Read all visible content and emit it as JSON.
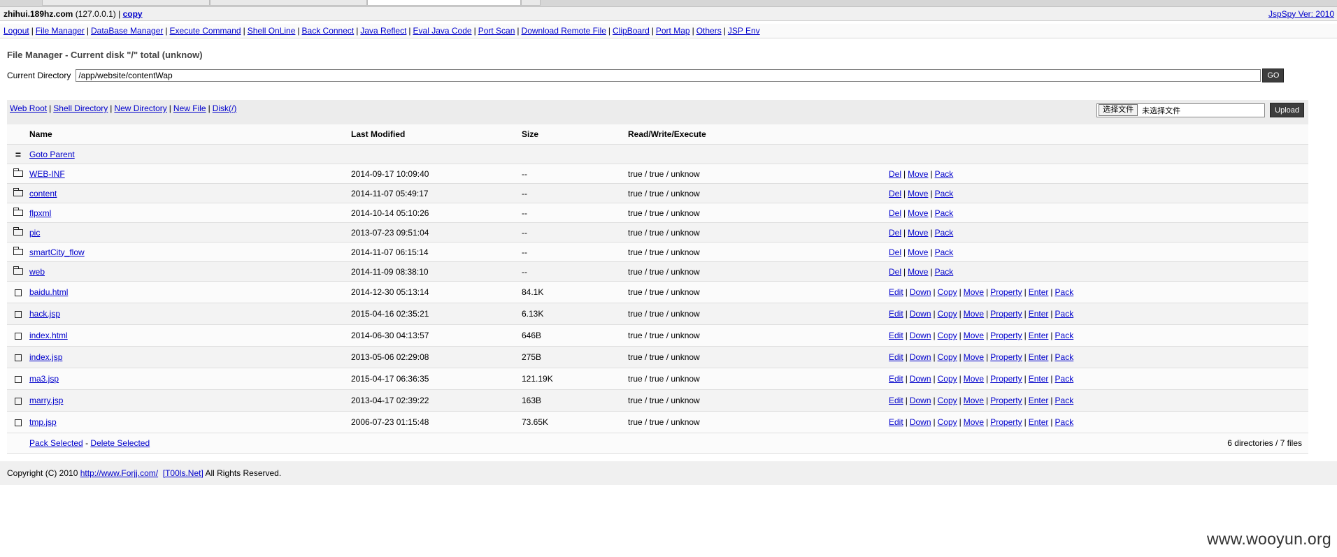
{
  "topbar": {
    "host": "zhihui.189hz.com",
    "ip": "(127.0.0.1)",
    "copy": "copy",
    "version": "JspSpy Ver: 2010"
  },
  "nav": [
    "Logout",
    "File Manager",
    "DataBase Manager",
    "Execute Command",
    "Shell OnLine",
    "Back Connect",
    "Java Reflect",
    "Eval Java Code",
    "Port Scan",
    "Download Remote File",
    "ClipBoard",
    "Port Map",
    "Others",
    "JSP Env"
  ],
  "heading": "File Manager - Current disk \"/\" total (unknow)",
  "current_dir": {
    "label": "Current Directory",
    "value": "/app/website/contentWap",
    "go": "GO"
  },
  "toolbar": {
    "links": [
      "Web Root",
      "Shell Directory",
      "New Directory",
      "New File",
      "Disk(/)"
    ],
    "choose_label": "选择文件",
    "no_file": "未选择文件",
    "upload": "Upload"
  },
  "columns": [
    "Name",
    "Last Modified",
    "Size",
    "Read/Write/Execute"
  ],
  "parent": {
    "icon": "=",
    "label": "Goto Parent"
  },
  "directories": [
    {
      "name": "WEB-INF",
      "modified": "2014-09-17 10:09:40",
      "size": "--",
      "rwx": "true / true / unknow"
    },
    {
      "name": "content",
      "modified": "2014-11-07 05:49:17",
      "size": "--",
      "rwx": "true / true / unknow"
    },
    {
      "name": "flpxml",
      "modified": "2014-10-14 05:10:26",
      "size": "--",
      "rwx": "true / true / unknow"
    },
    {
      "name": "pic",
      "modified": "2013-07-23 09:51:04",
      "size": "--",
      "rwx": "true / true / unknow"
    },
    {
      "name": "smartCity_flow",
      "modified": "2014-11-07 06:15:14",
      "size": "--",
      "rwx": "true / true / unknow"
    },
    {
      "name": "web",
      "modified": "2014-11-09 08:38:10",
      "size": "--",
      "rwx": "true / true / unknow"
    }
  ],
  "dir_actions": [
    "Del",
    "Move",
    "Pack"
  ],
  "files": [
    {
      "name": "baidu.html",
      "modified": "2014-12-30 05:13:14",
      "size": "84.1K",
      "rwx": "true / true / unknow"
    },
    {
      "name": "hack.jsp",
      "modified": "2015-04-16 02:35:21",
      "size": "6.13K",
      "rwx": "true / true / unknow"
    },
    {
      "name": "index.html",
      "modified": "2014-06-30 04:13:57",
      "size": "646B",
      "rwx": "true / true / unknow"
    },
    {
      "name": "index.jsp",
      "modified": "2013-05-06 02:29:08",
      "size": "275B",
      "rwx": "true / true / unknow"
    },
    {
      "name": "ma3.jsp",
      "modified": "2015-04-17 06:36:35",
      "size": "121.19K",
      "rwx": "true / true / unknow"
    },
    {
      "name": "marry.jsp",
      "modified": "2013-04-17 02:39:22",
      "size": "163B",
      "rwx": "true / true / unknow"
    },
    {
      "name": "tmp.jsp",
      "modified": "2006-07-23 01:15:48",
      "size": "73.65K",
      "rwx": "true / true / unknow"
    }
  ],
  "file_actions": [
    "Edit",
    "Down",
    "Copy",
    "Move",
    "Property",
    "Enter",
    "Pack"
  ],
  "footer": {
    "pack": "Pack Selected",
    "dash": "-",
    "delete": "Delete Selected",
    "summary": "6 directories / 7 files"
  },
  "copyright": {
    "prefix": "Copyright (C) 2010",
    "link1": "http://www.Forjj.com/",
    "link2": "[T00ls.Net]",
    "suffix": "All Rights Reserved."
  },
  "watermark": "www.wooyun.org",
  "icons": {
    "folder": "folder-icon",
    "file": "file-checkbox-icon",
    "parent": "parent-dir-icon"
  }
}
